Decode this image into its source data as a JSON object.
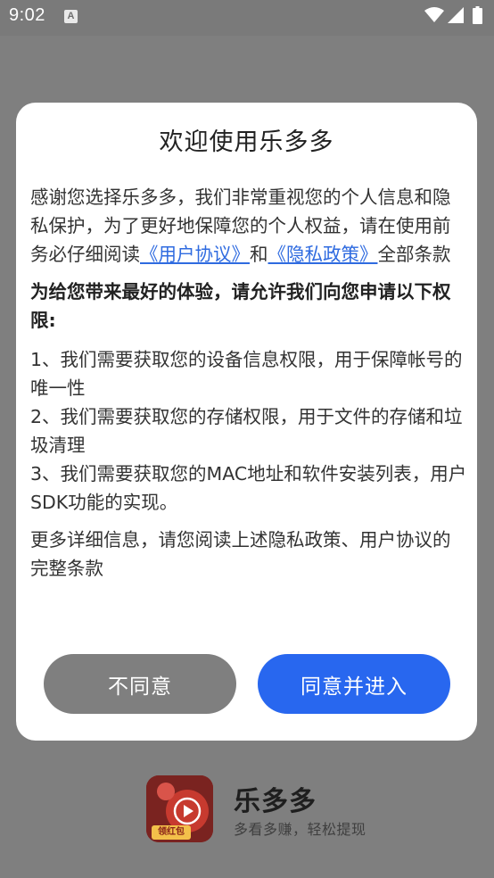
{
  "status_bar": {
    "time": "9:02",
    "notification_glyph": "A"
  },
  "dialog": {
    "title": "欢迎使用乐多多",
    "intro_before": "感谢您选择乐多多，我们非常重视您的个人信息和隐私保护，为了更好地保障您的个人权益，请在使用前务必仔细阅读",
    "link_user_agreement": "《用户协议》",
    "intro_and": "和",
    "link_privacy_policy": "《隐私政策》",
    "intro_after": "全部条款",
    "permission_heading": "为给您带来最好的体验，请允许我们向您申请以下权限:",
    "permissions": [
      "1、我们需要获取您的设备信息权限，用于保障帐号的唯一性",
      "2、我们需要获取您的存储权限，用于文件的存储和垃圾清理",
      "3、我们需要获取您的MAC地址和软件安装列表，用户SDK功能的实现。"
    ],
    "more_info": "更多详细信息，请您阅读上述隐私政策、用户协议的完整条款",
    "disagree_label": "不同意",
    "agree_label": "同意并进入"
  },
  "brand": {
    "name": "乐多多",
    "slogan": "多看多赚，轻松提现",
    "logo_badge": "领红包"
  },
  "colors": {
    "accent": "#2867ef",
    "link": "#2f6be0",
    "disagree_button": "#7f7f7f",
    "scrim": "#7f7f7f"
  },
  "icons": {
    "status": [
      "notification-a-icon",
      "wifi-icon",
      "signal-icon",
      "battery-icon"
    ],
    "brand": "app-logo-icon"
  }
}
